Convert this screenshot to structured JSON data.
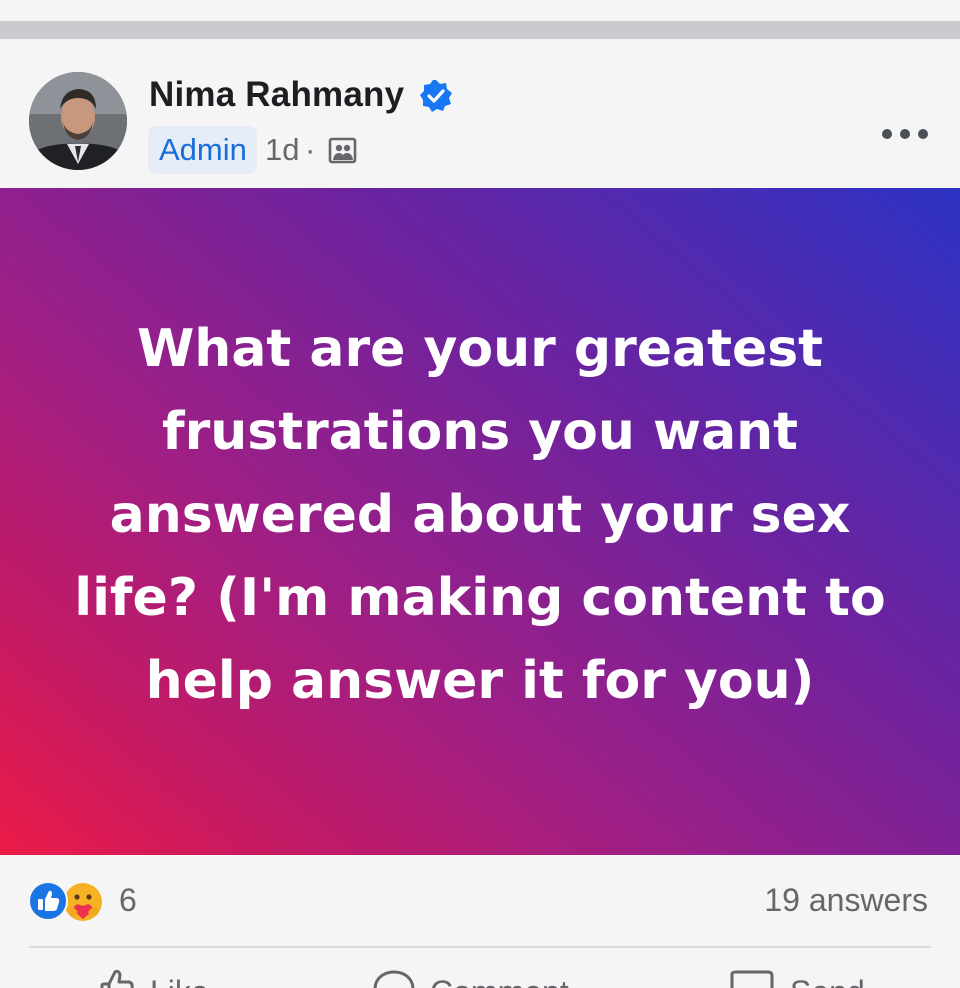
{
  "post": {
    "author": "Nima Rahmany",
    "role_badge": "Admin",
    "time": "1d",
    "separator": "·",
    "text": "What are your greatest frustrations you want answered about your sex life? (I'm making content to help answer it for you)",
    "icons": {
      "verified": "verified-badge-icon",
      "audience": "group-audience-icon",
      "more": "more-options-icon"
    },
    "colors": {
      "gradient_top_right": "#2d33c4",
      "gradient_bottom_left": "#ec1b47",
      "admin_badge_text": "#1a6ed8",
      "verified_badge": "#1877f2"
    }
  },
  "reactions": {
    "count": "6",
    "types": [
      "like-icon",
      "care-icon"
    ],
    "answers": "19 answers"
  },
  "actions": [
    {
      "label": "Like",
      "icon": "thumbs-up-icon"
    },
    {
      "label": "Comment",
      "icon": "comment-icon"
    },
    {
      "label": "Send",
      "icon": "send-icon"
    }
  ]
}
